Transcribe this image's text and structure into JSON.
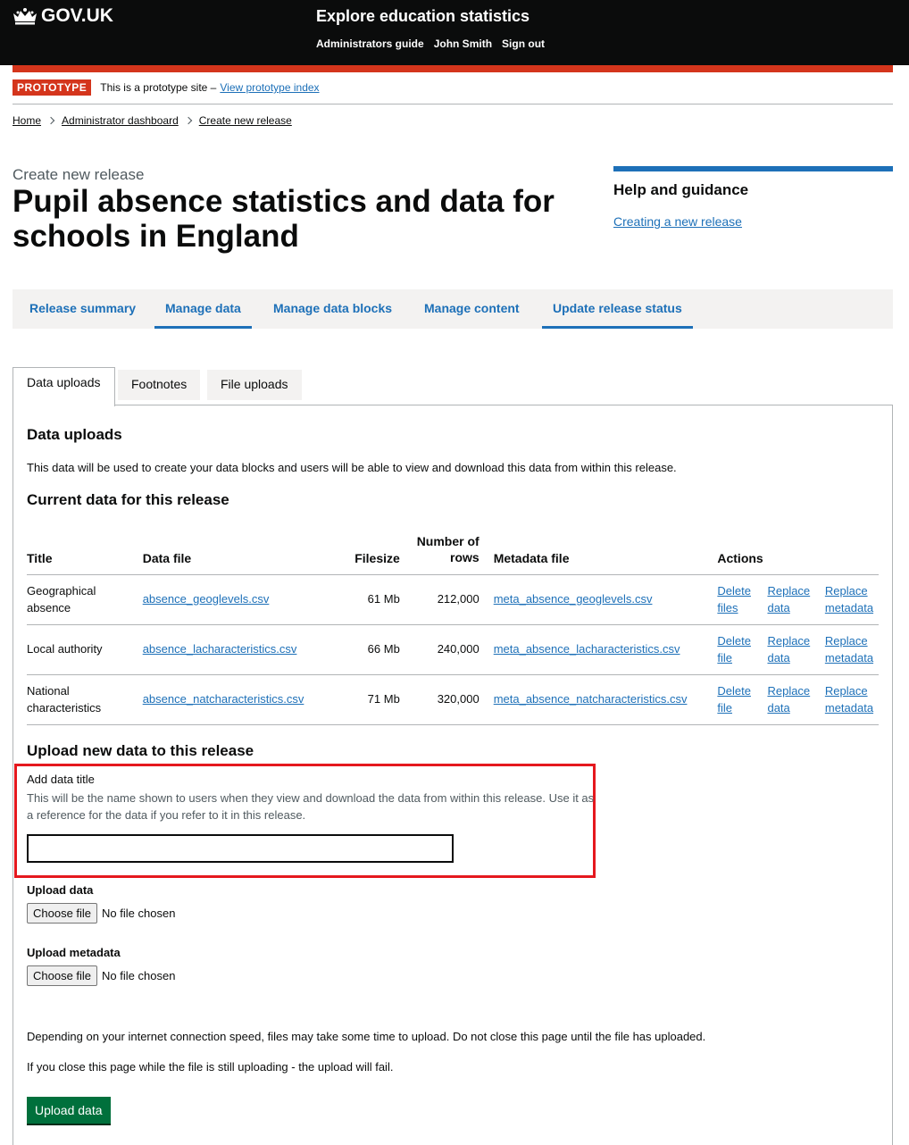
{
  "header": {
    "logo_text": "GOV.UK",
    "service_name": "Explore education statistics",
    "nav": [
      "Administrators guide",
      "John Smith",
      "Sign out"
    ]
  },
  "phase": {
    "tag": "PROTOTYPE",
    "text": "This is a prototype site –",
    "link": "View prototype index"
  },
  "breadcrumbs": [
    "Home",
    "Administrator dashboard",
    "Create new release"
  ],
  "page": {
    "caption": "Create new release",
    "title": "Pupil absence statistics and data for schools in England"
  },
  "aside": {
    "heading": "Help and guidance",
    "link": "Creating a new release"
  },
  "nav_tabs": [
    "Release summary",
    "Manage data",
    "Manage data blocks",
    "Manage content",
    "Update release status"
  ],
  "sub_tabs": [
    "Data uploads",
    "Footnotes",
    "File uploads"
  ],
  "data_uploads": {
    "heading": "Data uploads",
    "intro": "This data will be used to create your data blocks and users will be able to view and download this data from within this release.",
    "current_heading": "Current data for this release",
    "table": {
      "headers": [
        "Title",
        "Data file",
        "Filesize",
        "Number of rows",
        "Metadata file",
        "Actions"
      ],
      "rows": [
        {
          "title": "Geographical absence",
          "data_file": "absence_geoglevels.csv",
          "filesize": "61 Mb",
          "rows": "212,000",
          "metadata_file": "meta_absence_geoglevels.csv",
          "actions": [
            "Delete files",
            "Replace data",
            "Replace metadata"
          ]
        },
        {
          "title": "Local authority",
          "data_file": "absence_lacharacteristics.csv",
          "filesize": "66 Mb",
          "rows": "240,000",
          "metadata_file": "meta_absence_lacharacteristics.csv",
          "actions": [
            "Delete file",
            "Replace data",
            "Replace metadata"
          ]
        },
        {
          "title": "National characteristics",
          "data_file": "absence_natcharacteristics.csv",
          "filesize": "71 Mb",
          "rows": "320,000",
          "metadata_file": "meta_absence_natcharacteristics.csv",
          "actions": [
            "Delete file",
            "Replace data",
            "Replace metadata"
          ]
        }
      ]
    }
  },
  "upload_form": {
    "heading": "Upload new data to this release",
    "title_label": "Add data title",
    "title_hint": "This will be the name shown to users when they view and download the data from within this release. Use it as a reference for the data if you refer to it in this release.",
    "title_value": "",
    "data_label": "Upload data",
    "metadata_label": "Upload metadata",
    "choose_file": "Choose file",
    "no_file": "No file chosen",
    "notice_1": "Depending on your internet connection speed, files may take some time to upload. Do not close this page until the file has uploaded.",
    "notice_2": "If you close this page while the file is still uploading - the upload will fail.",
    "submit": "Upload data"
  },
  "colors": {
    "header": "#0b0c0c",
    "accent": "#1d70b8",
    "phase_tag": "#d4351c",
    "highlight_box": "#e5181e",
    "button": "#00703c"
  }
}
